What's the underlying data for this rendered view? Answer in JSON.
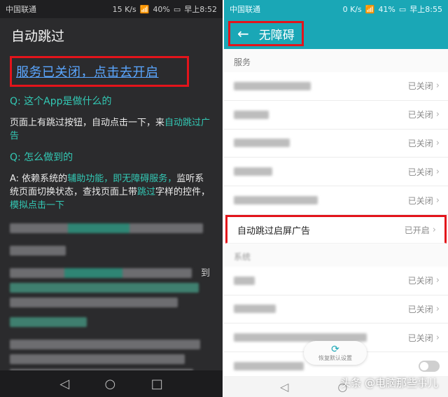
{
  "left": {
    "status": {
      "carrier": "中国联通",
      "speed": "15 K/s",
      "battery": "40%",
      "time": "早上8:52"
    },
    "title": "自动跳过",
    "service_link": "服务已关闭，点击去开启",
    "q1": "Q: 这个App是做什么的",
    "a1_prefix": "页面上有跳过按钮，自动点击一下，来",
    "a1_highlight": "自动跳过广告",
    "q2": "Q: 怎么做到的",
    "a2_part1": "A: 依赖系统的",
    "a2_hl1": "辅助功能，即无障碍服务，",
    "a2_part2": "监听系统页面切换状态，查找页面上带",
    "a2_hl2": "跳过",
    "a2_part3": "字样的控件，",
    "a2_hl3": "模拟点击一下",
    "blurred_glyph": "到"
  },
  "right": {
    "status": {
      "carrier": "中国联通",
      "speed": "0 K/s",
      "battery": "41%",
      "time": "早上8:55"
    },
    "title": "无障碍",
    "section_services": "服务",
    "status_off": "已关闭",
    "status_on": "已开启",
    "highlight_row": "自动跳过启屏广告",
    "section_system": "系统",
    "reset_label": "恢复默认设置"
  },
  "watermark": "头条 @电脑那些事儿",
  "colors": {
    "accent_red": "#e3141b",
    "teal": "#1aa7b6",
    "link_blue": "#5aa6ff",
    "green_text": "#33c9b5"
  }
}
